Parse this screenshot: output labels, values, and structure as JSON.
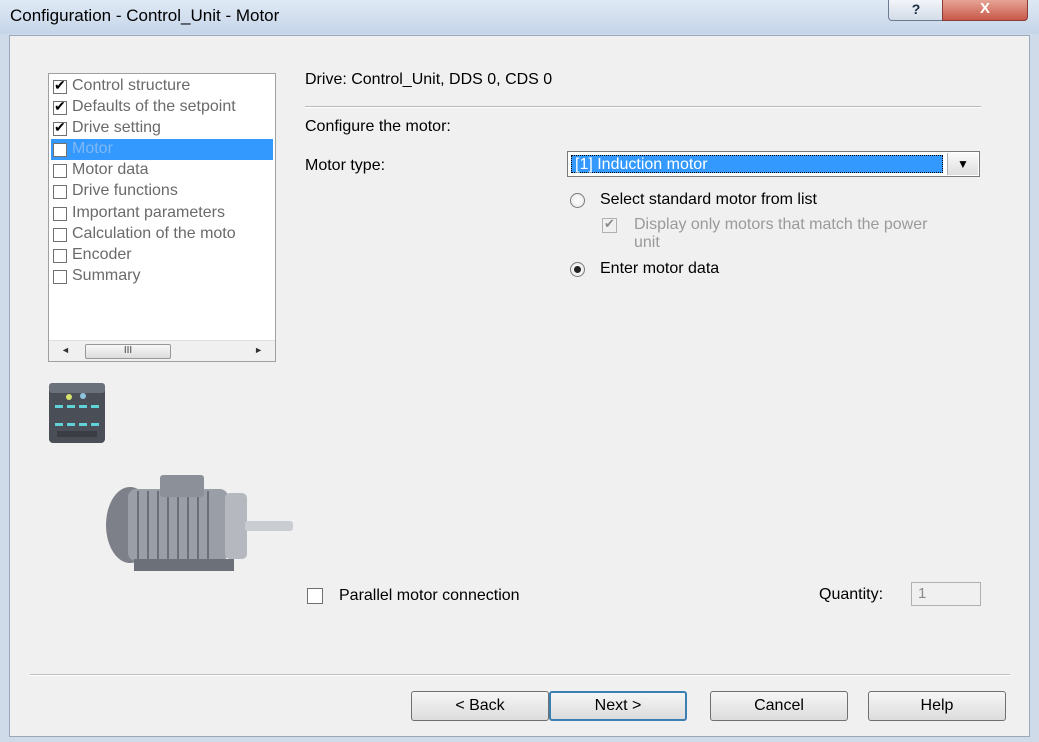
{
  "window": {
    "title": "Configuration - Control_Unit - Motor",
    "help_glyph": "?",
    "close_glyph": "X"
  },
  "tree": {
    "items": [
      {
        "label": "Control structure",
        "checked": true
      },
      {
        "label": "Defaults of the setpoint",
        "checked": true
      },
      {
        "label": "Drive setting",
        "checked": true
      },
      {
        "label": "Motor",
        "checked": false,
        "selected": true
      },
      {
        "label": "Motor data",
        "checked": false
      },
      {
        "label": "Drive functions",
        "checked": false
      },
      {
        "label": "Important parameters",
        "checked": false
      },
      {
        "label": "Calculation of the moto",
        "checked": false
      },
      {
        "label": "Encoder",
        "checked": false
      },
      {
        "label": "Summary",
        "checked": false
      }
    ],
    "scroll_left": "◄",
    "scroll_right": "►",
    "scroll_thumb": "III"
  },
  "main": {
    "drive_label": "Drive: Control_Unit, DDS 0, CDS 0",
    "configure_label": "Configure the motor:",
    "motor_type_label": "Motor type:",
    "motor_type_value": "[1] Induction motor",
    "combo_arrow": "▼",
    "radio_standard": "Select standard motor from list",
    "display_only_matching": "Display only motors that match the power unit",
    "radio_enter": "Enter motor data",
    "parallel_label": "Parallel motor connection",
    "quantity_label": "Quantity:",
    "quantity_value": "1"
  },
  "buttons": {
    "back": "< Back",
    "next": "Next >",
    "cancel": "Cancel",
    "help": "Help"
  },
  "colors": {
    "selection": "#3399ff",
    "dialog_bg": "#f0f0f0",
    "titlebar": "#c5d5e8",
    "close_button": "#c8584a"
  }
}
